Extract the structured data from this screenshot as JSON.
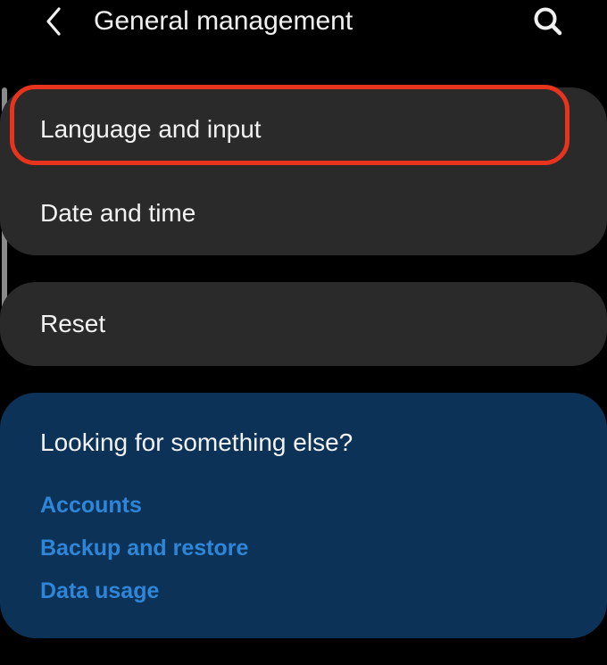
{
  "header": {
    "title": "General management",
    "back_icon": "back-arrow-icon",
    "search_icon": "search-icon"
  },
  "menu": {
    "group1": [
      {
        "label": "Language and input",
        "highlighted": true
      },
      {
        "label": "Date and time",
        "highlighted": false
      }
    ],
    "group2": [
      {
        "label": "Reset"
      }
    ]
  },
  "suggestions": {
    "title": "Looking for something else?",
    "links": [
      {
        "label": "Accounts"
      },
      {
        "label": "Backup and restore"
      },
      {
        "label": "Data usage"
      }
    ]
  },
  "colors": {
    "background": "#000000",
    "card": "#2a2a2a",
    "suggestion_card": "#0c3357",
    "link": "#2f86d8",
    "highlight": "#e8341c"
  }
}
